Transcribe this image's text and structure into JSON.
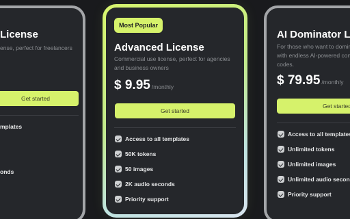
{
  "plans": [
    {
      "title": "License",
      "description": "ense, perfect for freelancers",
      "cta": "Get started",
      "features": [
        "mplates",
        "",
        "",
        "onds"
      ]
    },
    {
      "badge": "Most Popular",
      "title": "Advanced License",
      "description": "Commercial use license, perfect for agencies and business owners",
      "price": "$ 9.95",
      "period": "/monthly",
      "cta": "Get started",
      "features": [
        "Access to all templates",
        "50K tokens",
        "50 images",
        "2K audio seconds",
        "Priority support"
      ]
    },
    {
      "title": "AI Dominator Lic",
      "description": "For those who want to domina with endless AI-powered conte codes.",
      "price": "$ 79.95",
      "period": "/monthly",
      "cta": "Get started",
      "features": [
        "Access to all templates",
        "Unlimited tokens",
        "Unlimited images",
        "Unlimited audio seconds",
        "Priority support"
      ]
    }
  ],
  "colors": {
    "accent": "#d6f26b",
    "card_background": "#25272b",
    "page_background": "#191a1d",
    "muted_text": "#8a8d91",
    "side_border": "#a3a5a8"
  },
  "icons": {
    "feature_check": "check-icon"
  }
}
